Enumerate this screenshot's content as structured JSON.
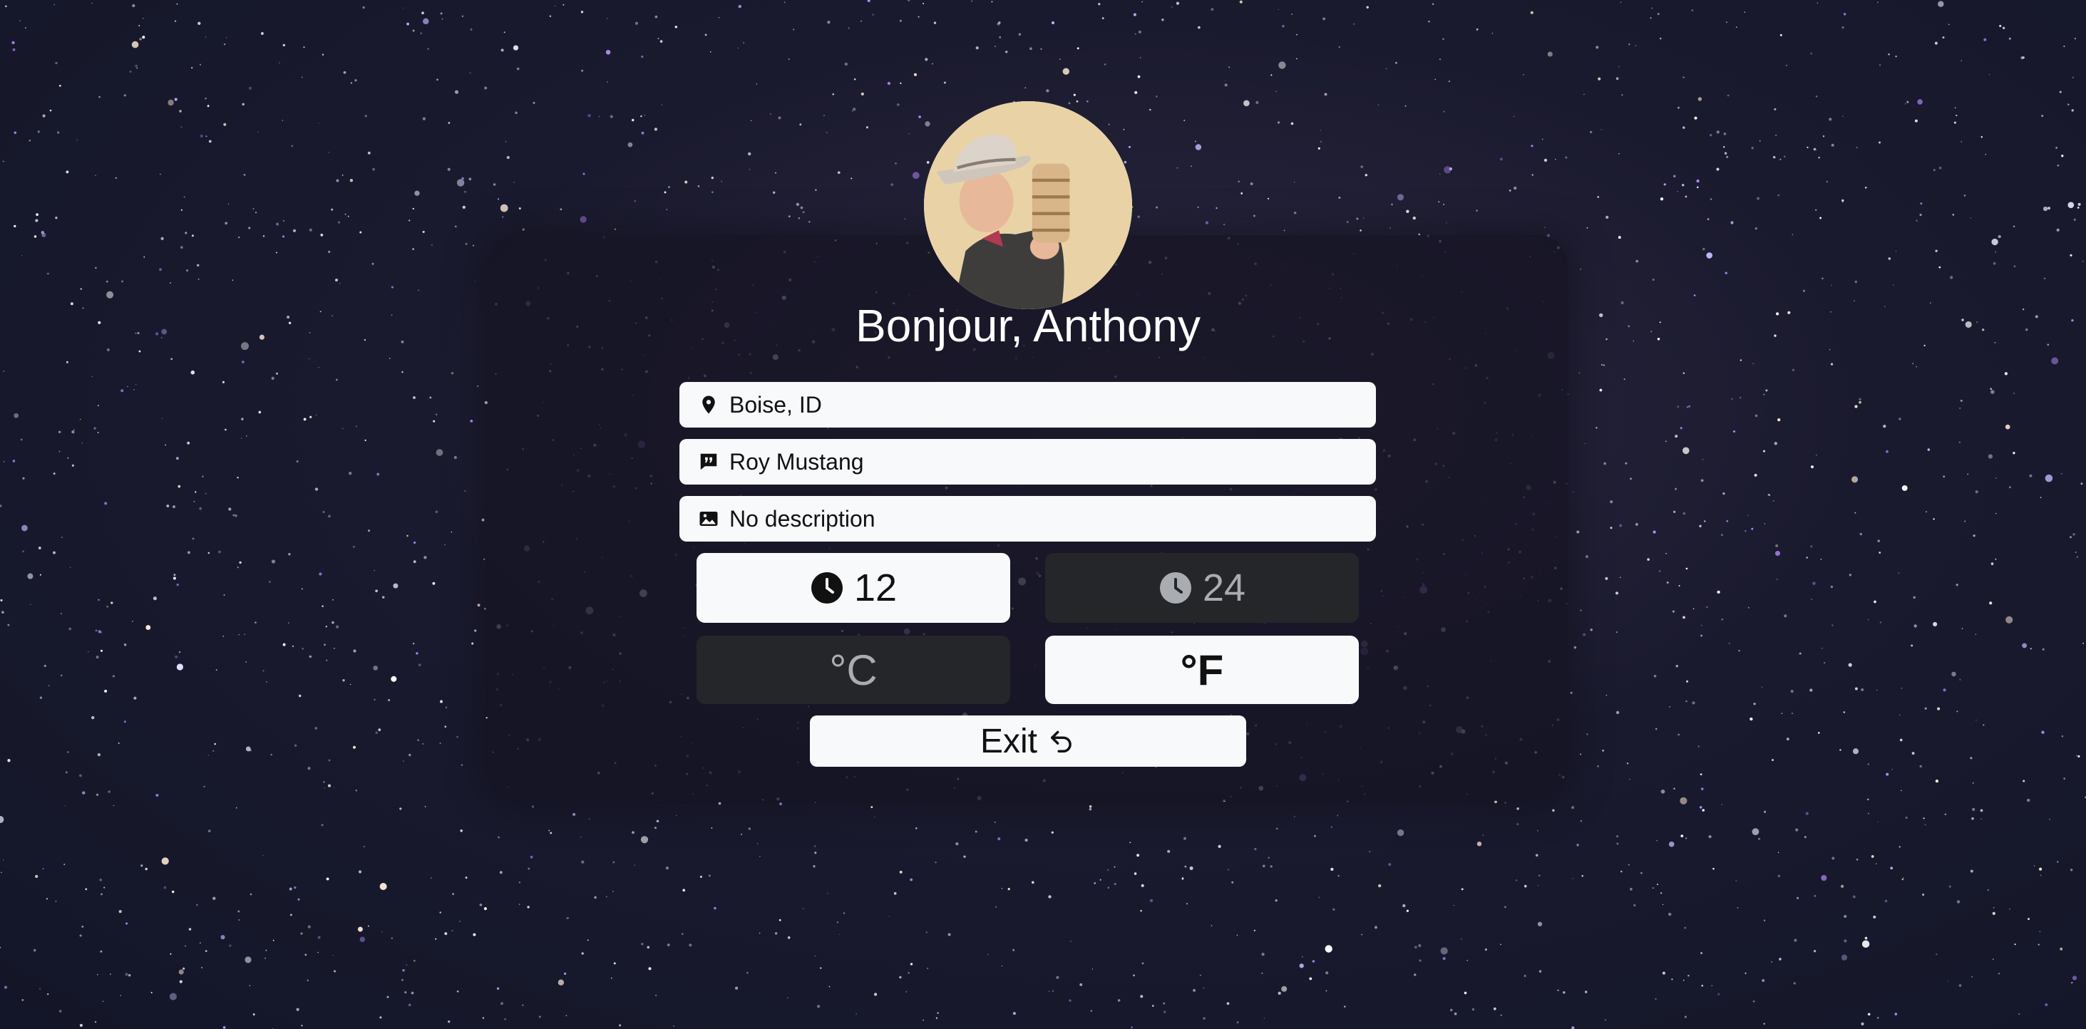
{
  "greeting": "Bonjour, Anthony",
  "profile": {
    "location": {
      "icon": "map-pin-icon",
      "value": "Boise, ID"
    },
    "quote": {
      "icon": "quote-bubble-icon",
      "value": "Roy Mustang"
    },
    "description": {
      "icon": "image-icon",
      "value": "No description"
    }
  },
  "clock_format": {
    "icon": "clock-icon",
    "options": [
      {
        "label": "12",
        "selected": true
      },
      {
        "label": "24",
        "selected": false
      }
    ]
  },
  "temperature_unit": {
    "options": [
      {
        "label": "°C",
        "selected": false
      },
      {
        "label": "°F",
        "selected": true
      }
    ]
  },
  "exit": {
    "label": "Exit",
    "icon": "undo-arrow-icon"
  },
  "colors": {
    "card_bg": "#161424",
    "button_active": "#f8f9fb",
    "button_inactive": "#242629",
    "text_inactive": "#a9acb1"
  }
}
